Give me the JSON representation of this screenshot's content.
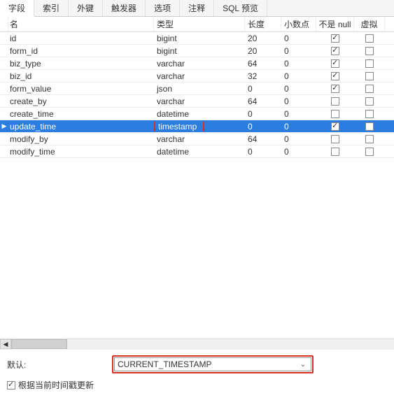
{
  "tabs": {
    "items": [
      "字段",
      "索引",
      "外键",
      "触发器",
      "选项",
      "注释",
      "SQL 预览"
    ],
    "activeIndex": 0
  },
  "columns": {
    "name": "名",
    "type": "类型",
    "length": "长度",
    "decimal": "小数点",
    "notnull": "不是 null",
    "virtual": "虚拟"
  },
  "rows": [
    {
      "name": "id",
      "type": "bigint",
      "len": "20",
      "dec": "0",
      "notnull": true,
      "virt": false,
      "selected": false,
      "hl": false
    },
    {
      "name": "form_id",
      "type": "bigint",
      "len": "20",
      "dec": "0",
      "notnull": true,
      "virt": false,
      "selected": false,
      "hl": false
    },
    {
      "name": "biz_type",
      "type": "varchar",
      "len": "64",
      "dec": "0",
      "notnull": true,
      "virt": false,
      "selected": false,
      "hl": false
    },
    {
      "name": "biz_id",
      "type": "varchar",
      "len": "32",
      "dec": "0",
      "notnull": true,
      "virt": false,
      "selected": false,
      "hl": false
    },
    {
      "name": "form_value",
      "type": "json",
      "len": "0",
      "dec": "0",
      "notnull": true,
      "virt": false,
      "selected": false,
      "hl": false
    },
    {
      "name": "create_by",
      "type": "varchar",
      "len": "64",
      "dec": "0",
      "notnull": false,
      "virt": false,
      "selected": false,
      "hl": false
    },
    {
      "name": "create_time",
      "type": "datetime",
      "len": "0",
      "dec": "0",
      "notnull": false,
      "virt": false,
      "selected": false,
      "hl": false
    },
    {
      "name": "update_time",
      "type": "timestamp",
      "len": "0",
      "dec": "0",
      "notnull": true,
      "virt": false,
      "selected": true,
      "hl": true
    },
    {
      "name": "modify_by",
      "type": "varchar",
      "len": "64",
      "dec": "0",
      "notnull": false,
      "virt": false,
      "selected": false,
      "hl": false
    },
    {
      "name": "modify_time",
      "type": "datetime",
      "len": "0",
      "dec": "0",
      "notnull": false,
      "virt": false,
      "selected": false,
      "hl": false
    }
  ],
  "bottom": {
    "default_label": "默认:",
    "default_value": "CURRENT_TIMESTAMP",
    "onupdate_label": "根据当前时间戳更新",
    "onupdate_checked": true
  },
  "icons": {
    "row_arrow": "▶",
    "caret_down": "⌄",
    "scroll_left": "◀"
  }
}
